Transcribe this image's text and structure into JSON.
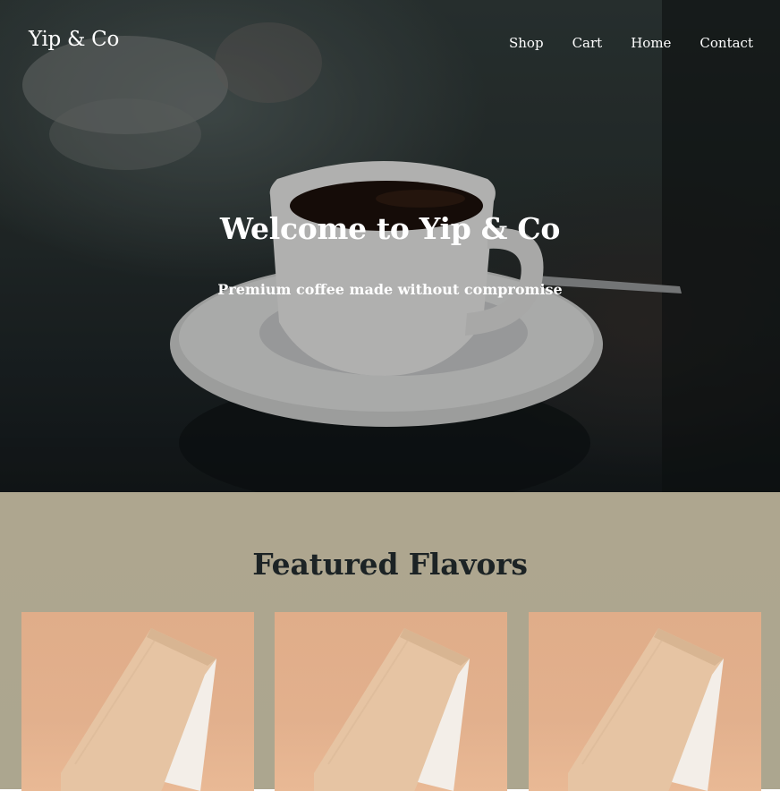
{
  "header": {
    "brand": "Yip & Co",
    "nav": [
      {
        "label": "Shop"
      },
      {
        "label": "Cart"
      },
      {
        "label": "Home"
      },
      {
        "label": "Contact"
      }
    ]
  },
  "hero": {
    "title": "Welcome to Yip & Co",
    "subtitle": "Premium coffee made without compromise"
  },
  "featured": {
    "title": "Featured Flavors",
    "products": [
      {
        "image": "coffee-bag-image"
      },
      {
        "image": "coffee-bag-image"
      },
      {
        "image": "coffee-bag-image"
      }
    ]
  },
  "colors": {
    "hero_dark": "#1c2325",
    "featured_bg": "#aea68f",
    "card_bg": "#e0ad89",
    "bag": "#e8c8a8",
    "text_dark": "#1c2325"
  }
}
